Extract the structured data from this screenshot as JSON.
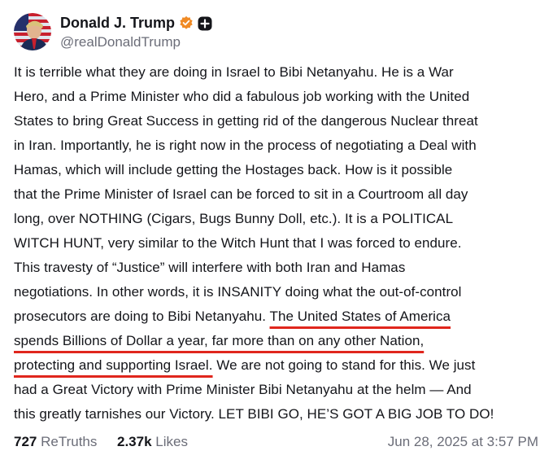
{
  "author": {
    "display_name": "Donald J. Trump",
    "handle": "@realDonaldTrump"
  },
  "icons": {
    "avatar": "user-avatar",
    "verified": "verified-badge-icon",
    "plus": "plus-badge-icon"
  },
  "colors": {
    "verified": "#f08a24",
    "underline": "#e0261d",
    "muted": "#6b6d78"
  },
  "post": {
    "lines": [
      "It is terrible what they are doing in Israel to Bibi Netanyahu. He is a War",
      "Hero, and a Prime Minister who did a fabulous job working with the United",
      "States to bring Great Success in getting rid of the dangerous Nuclear threat",
      "in Iran. Importantly, he is right now in the process of negotiating a Deal with",
      "Hamas, which will include getting the Hostages back. How is it possible",
      "that the Prime Minister of Israel can be forced to sit in a Courtroom all day",
      "long, over NOTHING (Cigars, Bugs Bunny Doll, etc.). It is a POLITICAL",
      "WITCH HUNT, very similar to the Witch Hunt that I was forced to endure.",
      "This travesty of “Justice” will interfere with both Iran and Hamas",
      "negotiations. In other words, it is INSANITY doing what the out-of-control"
    ],
    "line11_plain": "prosecutors are doing to Bibi Netanyahu. ",
    "line11_underlined": "The United States of America",
    "line12_underlined": "spends Billions of Dollar a year, far more than on any other Nation,",
    "line13_underlined": "protecting and supporting Israel.",
    "line13_plain": " We are not going to stand for this. We just",
    "line14": "had a Great Victory with Prime Minister Bibi Netanyahu at the helm — And",
    "line15": "this greatly tarnishes our Victory. LET BIBI GO, HE’S GOT A BIG JOB TO DO!"
  },
  "stats": {
    "retruths_count": "727",
    "retruths_label": "ReTruths",
    "likes_count": "2.37k",
    "likes_label": "Likes"
  },
  "timestamp": "Jun 28, 2025 at 3:57 PM"
}
